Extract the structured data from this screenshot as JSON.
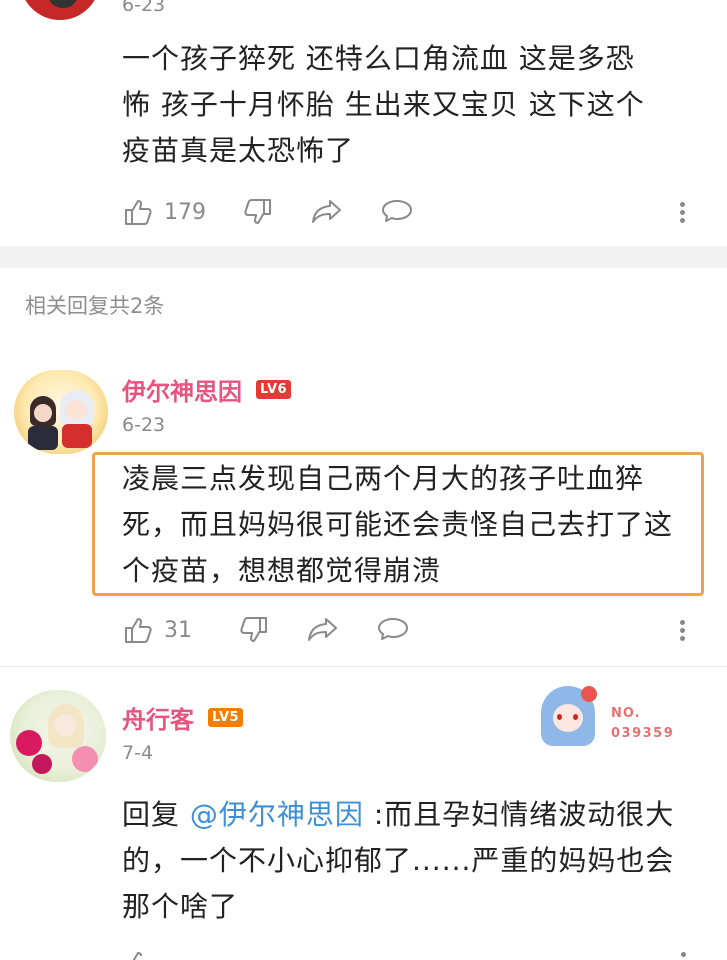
{
  "top_comment": {
    "date": "6-23",
    "text_lines": [
      "一个孩子猝死  还特么口角流血  这是多恐",
      "怖  孩子十月怀胎  生出来又宝贝  这下这个",
      "疫苗真是太恐怖了"
    ],
    "likes": "179"
  },
  "replies_header": "相关回复共2条",
  "reply1": {
    "username": "伊尔神思因",
    "level": "LV6",
    "date": "6-23",
    "text_lines": [
      "凌晨三点发现自己两个月大的孩子吐血猝",
      "死，而且妈妈很可能还会责怪自己去打了这",
      "个疫苗，想想都觉得崩溃"
    ],
    "likes": "31"
  },
  "reply2": {
    "username": "舟行客",
    "level": "LV5",
    "date": "7-4",
    "reply_prefix": "回复 ",
    "mention": "@伊尔神思因",
    "text_line1_rest": " :而且孕妇情绪波动很大",
    "text_lines": [
      "的，一个不小心抑郁了......严重的妈妈也会",
      "那个啥了"
    ],
    "fan_badge_label": "NO.",
    "fan_badge_number": "039359"
  },
  "colors": {
    "username": "#e75480",
    "highlight_border": "#f0a24a",
    "mention": "#3d8fd6",
    "lv6": "#e53935",
    "lv5": "#f57c00"
  }
}
